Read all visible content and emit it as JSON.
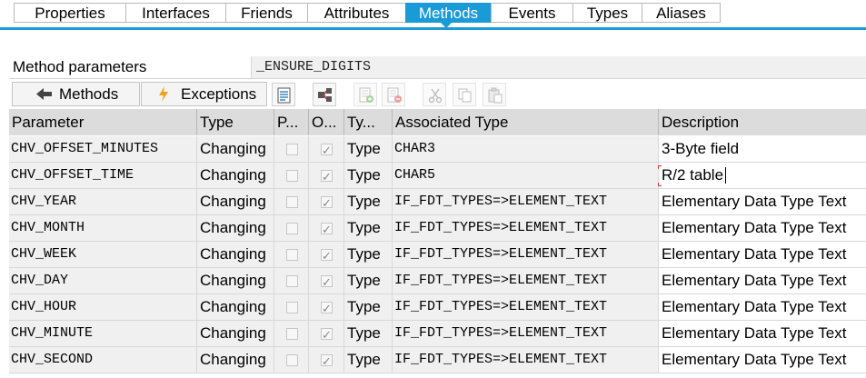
{
  "tabs": [
    {
      "label": "Properties",
      "active": false
    },
    {
      "label": "Interfaces",
      "active": false
    },
    {
      "label": "Friends",
      "active": false
    },
    {
      "label": "Attributes",
      "active": false
    },
    {
      "label": "Methods",
      "active": true
    },
    {
      "label": "Events",
      "active": false
    },
    {
      "label": "Types",
      "active": false
    },
    {
      "label": "Aliases",
      "active": false
    }
  ],
  "method_parameters": {
    "label": "Method parameters",
    "value": "_ENSURE_DIGITS"
  },
  "toolbar": {
    "methods_label": "Methods",
    "exceptions_label": "Exceptions",
    "icons": [
      "detail-view-icon",
      "where-used-icon",
      "insert-row-icon",
      "delete-row-icon",
      "cut-icon",
      "copy-icon",
      "paste-icon"
    ]
  },
  "columns": {
    "parameter": "Parameter",
    "type": "Type",
    "pass_value": "P...",
    "optional": "O...",
    "typing": "Ty...",
    "associated_type": "Associated Type",
    "description": "Description"
  },
  "rows": [
    {
      "parameter": "CHV_OFFSET_MINUTES",
      "type": "Changing",
      "pass_value": false,
      "optional": true,
      "typing": "Type",
      "associated_type": "CHAR3",
      "description": "3-Byte field"
    },
    {
      "parameter": "CHV_OFFSET_TIME",
      "type": "Changing",
      "pass_value": false,
      "optional": true,
      "typing": "Type",
      "associated_type": "CHAR5",
      "description": "R/2 table"
    },
    {
      "parameter": "CHV_YEAR",
      "type": "Changing",
      "pass_value": false,
      "optional": true,
      "typing": "Type",
      "associated_type": "IF_FDT_TYPES=>ELEMENT_TEXT",
      "description": "Elementary Data Type Text"
    },
    {
      "parameter": "CHV_MONTH",
      "type": "Changing",
      "pass_value": false,
      "optional": true,
      "typing": "Type",
      "associated_type": "IF_FDT_TYPES=>ELEMENT_TEXT",
      "description": "Elementary Data Type Text"
    },
    {
      "parameter": "CHV_WEEK",
      "type": "Changing",
      "pass_value": false,
      "optional": true,
      "typing": "Type",
      "associated_type": "IF_FDT_TYPES=>ELEMENT_TEXT",
      "description": "Elementary Data Type Text"
    },
    {
      "parameter": "CHV_DAY",
      "type": "Changing",
      "pass_value": false,
      "optional": true,
      "typing": "Type",
      "associated_type": "IF_FDT_TYPES=>ELEMENT_TEXT",
      "description": "Elementary Data Type Text"
    },
    {
      "parameter": "CHV_HOUR",
      "type": "Changing",
      "pass_value": false,
      "optional": true,
      "typing": "Type",
      "associated_type": "IF_FDT_TYPES=>ELEMENT_TEXT",
      "description": "Elementary Data Type Text"
    },
    {
      "parameter": "CHV_MINUTE",
      "type": "Changing",
      "pass_value": false,
      "optional": true,
      "typing": "Type",
      "associated_type": "IF_FDT_TYPES=>ELEMENT_TEXT",
      "description": "Elementary Data Type Text"
    },
    {
      "parameter": "CHV_SECOND",
      "type": "Changing",
      "pass_value": false,
      "optional": true,
      "typing": "Type",
      "associated_type": "IF_FDT_TYPES=>ELEMENT_TEXT",
      "description": "Elementary Data Type Text"
    }
  ],
  "colors": {
    "accent": "#1a9ad7",
    "header_bg": "#dcdcdc",
    "readonly_cell_bg": "#f0f0f0"
  }
}
